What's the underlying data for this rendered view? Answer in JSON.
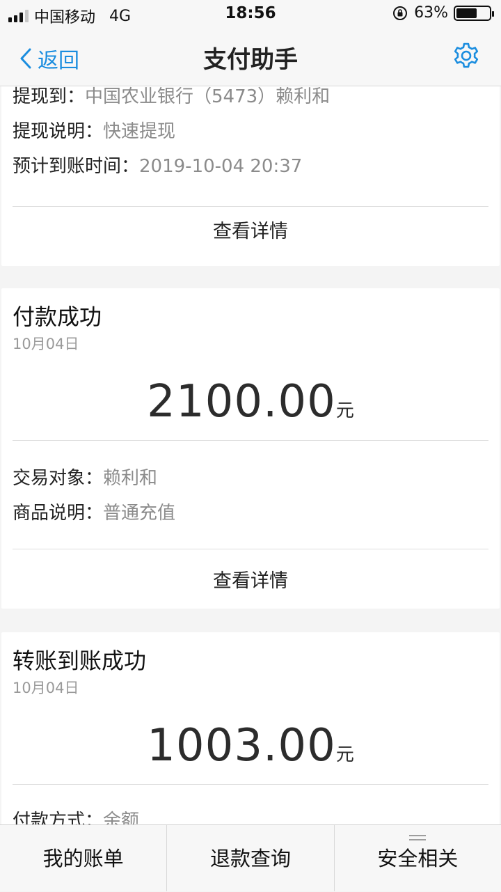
{
  "status": {
    "carrier": "中国移动",
    "network": "4G",
    "time": "18:56",
    "battery": "63%",
    "battery_level": 0.63
  },
  "nav": {
    "back_label": "返回",
    "title": "支付助手",
    "settings_icon": "gear-icon"
  },
  "card1": {
    "rows": [
      {
        "key": "提现到：",
        "value": "中国农业银行（5473）赖利和"
      },
      {
        "key": "提现说明：",
        "value": "快速提现"
      },
      {
        "key": "预计到账时间：",
        "value": "2019-10-04 20:37"
      }
    ],
    "detail_label": "查看详情"
  },
  "card2": {
    "title": "付款成功",
    "date": "10月04日",
    "amount": "2100.00",
    "unit": "元",
    "rows": [
      {
        "key": "交易对象：",
        "value": "赖利和"
      },
      {
        "key": "商品说明：",
        "value": "普通充值"
      }
    ],
    "detail_label": "查看详情"
  },
  "card3": {
    "title": "转账到账成功",
    "date": "10月04日",
    "amount": "1003.00",
    "unit": "元",
    "rows": [
      {
        "key": "付款方式：",
        "value": "余额"
      }
    ]
  },
  "tabs": [
    {
      "label": "我的账单"
    },
    {
      "label": "退款查询"
    },
    {
      "label": "安全相关"
    }
  ],
  "colors": {
    "accent": "#1a8ddf",
    "muted": "#8b8b8b",
    "background": "#f4f4f4"
  }
}
